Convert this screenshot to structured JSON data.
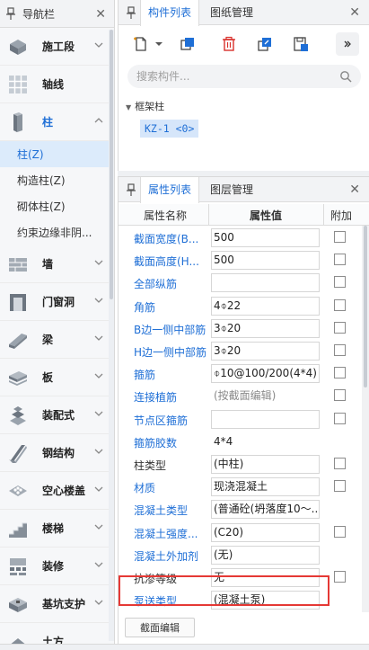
{
  "nav": {
    "title": "导航栏",
    "items": [
      {
        "label": "施工段",
        "icon": "construction-segment-icon"
      },
      {
        "label": "轴线",
        "icon": "axis-grid-icon"
      },
      {
        "label": "柱",
        "icon": "column-icon",
        "expanded": true
      },
      {
        "label": "墙",
        "icon": "wall-icon"
      },
      {
        "label": "门窗洞",
        "icon": "door-window-icon"
      },
      {
        "label": "梁",
        "icon": "beam-icon"
      },
      {
        "label": "板",
        "icon": "slab-icon"
      },
      {
        "label": "装配式",
        "icon": "prefab-icon"
      },
      {
        "label": "钢结构",
        "icon": "steel-structure-icon"
      },
      {
        "label": "空心楼盖",
        "icon": "hollow-floor-icon"
      },
      {
        "label": "楼梯",
        "icon": "stairs-icon"
      },
      {
        "label": "装修",
        "icon": "decoration-icon"
      },
      {
        "label": "基坑支护",
        "icon": "pit-support-icon"
      },
      {
        "label": "土方",
        "icon": "earthwork-icon"
      }
    ],
    "subitems": [
      "柱(Z)",
      "构造柱(Z)",
      "砌体柱(Z)",
      "约束边缘非阴..."
    ]
  },
  "components": {
    "tab_active": "构件列表",
    "tab_inactive": "图纸管理",
    "search_placeholder": "搜索构件...",
    "group": "框架柱",
    "item": "KZ-1 <0>"
  },
  "properties": {
    "tab_active": "属性列表",
    "tab_inactive": "图层管理",
    "col_name": "属性名称",
    "col_value": "属性值",
    "col_extra": "附加",
    "rows": [
      {
        "name": "截面宽度(B...",
        "value": "500",
        "blue": true,
        "box": true,
        "check": true
      },
      {
        "name": "截面高度(H...",
        "value": "500",
        "blue": true,
        "box": true,
        "check": true
      },
      {
        "name": "全部纵筋",
        "value": "",
        "blue": true,
        "box": true,
        "check": true
      },
      {
        "name": "角筋",
        "value": "4⌽22",
        "blue": true,
        "box": true,
        "check": true
      },
      {
        "name": "B边一侧中部筋",
        "value": "3⌽20",
        "blue": true,
        "box": true,
        "check": true
      },
      {
        "name": "H边一侧中部筋",
        "value": "3⌽20",
        "blue": true,
        "box": true,
        "check": true
      },
      {
        "name": "箍筋",
        "value": "⌽10@100/200(4*4)",
        "blue": true,
        "box": true,
        "check": true
      },
      {
        "name": "连接植筋",
        "value": "(按截面编辑)",
        "blue": true,
        "box": false,
        "gray": true,
        "check": true
      },
      {
        "name": "节点区箍筋",
        "value": "",
        "blue": true,
        "box": true,
        "check": true
      },
      {
        "name": "箍筋胶数",
        "value": "4*4",
        "blue": true,
        "box": false,
        "check": false
      },
      {
        "name": "柱类型",
        "value": "(中柱)",
        "blue": false,
        "box": true,
        "check": true
      },
      {
        "name": "材质",
        "value": "现浇混凝土",
        "blue": true,
        "box": true,
        "check": true
      },
      {
        "name": "混凝土类型",
        "value": "(普通砼(坍落度10～...",
        "blue": true,
        "box": true,
        "check": false
      },
      {
        "name": "混凝土强度...",
        "value": "(C20)",
        "blue": true,
        "box": true,
        "check": true
      },
      {
        "name": "混凝土外加剂",
        "value": "(无)",
        "blue": true,
        "box": true,
        "check": false
      },
      {
        "name": "抗渗等级",
        "value": "无",
        "blue": false,
        "box": true,
        "check": true
      },
      {
        "name": "泵送类型",
        "value": "(混凝土泵)",
        "blue": true,
        "box": true,
        "check": false
      }
    ],
    "edit_button": "截面编辑"
  }
}
